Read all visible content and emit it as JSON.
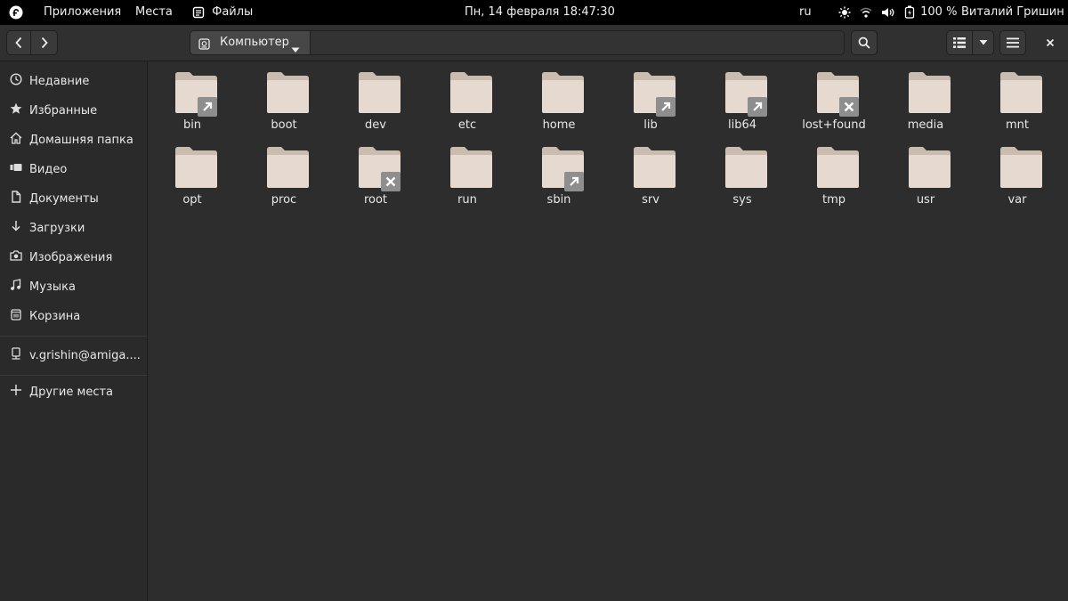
{
  "topbar": {
    "apps_label": "Приложения",
    "places_label": "Места",
    "files_label": "Файлы",
    "clock": "Пн, 14 февраля  18:47:30",
    "keyboard_layout": "ru",
    "battery": "100 %",
    "user": "Виталий Гришин"
  },
  "header": {
    "path_segment": "Компьютер"
  },
  "sidebar": {
    "items": [
      {
        "label": "Недавние",
        "icon": "clock-icon"
      },
      {
        "label": "Избранные",
        "icon": "star-icon"
      },
      {
        "label": "Домашняя папка",
        "icon": "home-icon"
      },
      {
        "label": "Видео",
        "icon": "video-icon"
      },
      {
        "label": "Документы",
        "icon": "document-icon"
      },
      {
        "label": "Загрузки",
        "icon": "download-icon"
      },
      {
        "label": "Изображения",
        "icon": "camera-icon"
      },
      {
        "label": "Музыка",
        "icon": "music-icon"
      },
      {
        "label": "Корзина",
        "icon": "trash-icon"
      }
    ],
    "network": "v.grishin@amiga....",
    "other_places": "Другие места"
  },
  "files": [
    {
      "name": "bin",
      "emblem": "symlink"
    },
    {
      "name": "boot",
      "emblem": ""
    },
    {
      "name": "dev",
      "emblem": ""
    },
    {
      "name": "etc",
      "emblem": ""
    },
    {
      "name": "home",
      "emblem": ""
    },
    {
      "name": "lib",
      "emblem": "symlink"
    },
    {
      "name": "lib64",
      "emblem": "symlink"
    },
    {
      "name": "lost+found",
      "emblem": "unreadable"
    },
    {
      "name": "media",
      "emblem": ""
    },
    {
      "name": "mnt",
      "emblem": ""
    },
    {
      "name": "opt",
      "emblem": ""
    },
    {
      "name": "proc",
      "emblem": ""
    },
    {
      "name": "root",
      "emblem": "unreadable"
    },
    {
      "name": "run",
      "emblem": ""
    },
    {
      "name": "sbin",
      "emblem": "symlink"
    },
    {
      "name": "srv",
      "emblem": ""
    },
    {
      "name": "sys",
      "emblem": ""
    },
    {
      "name": "tmp",
      "emblem": ""
    },
    {
      "name": "usr",
      "emblem": ""
    },
    {
      "name": "var",
      "emblem": ""
    }
  ],
  "colors": {
    "folder_body": "#e6d9cf",
    "folder_tab": "#cbbcb0",
    "emblem_bg": "#8e8e8e"
  }
}
